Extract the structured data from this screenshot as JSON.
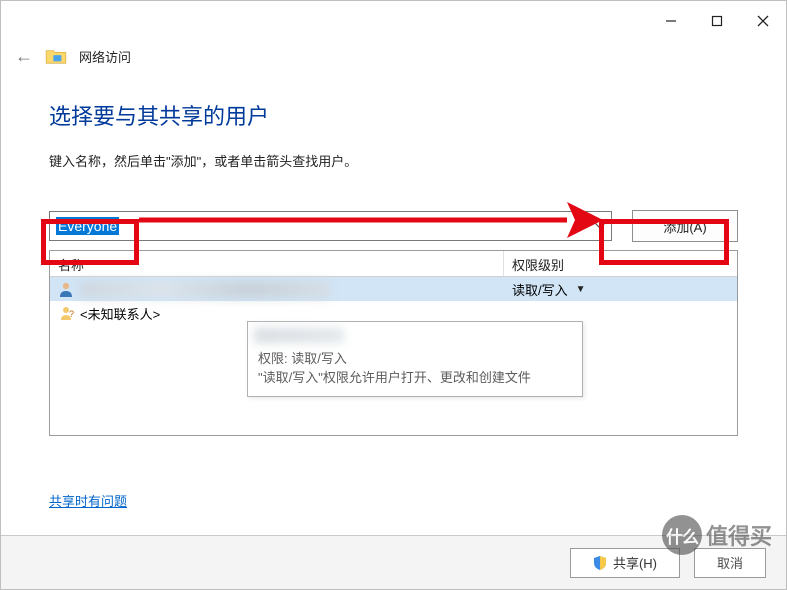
{
  "header": {
    "title": "网络访问"
  },
  "main": {
    "heading": "选择要与其共享的用户",
    "instruction": "键入名称，然后单击\"添加\"，或者单击箭头查找用户。"
  },
  "input": {
    "value": "Everyone"
  },
  "buttons": {
    "add": "添加(A)",
    "share": "共享(H)",
    "cancel": "取消"
  },
  "table": {
    "header_name": "名称",
    "header_perm": "权限级别",
    "rows": [
      {
        "name_redacted": true,
        "perm": "读取/写入",
        "selected": true,
        "icon": "user"
      },
      {
        "name": "<未知联系人>",
        "perm": "",
        "selected": false,
        "icon": "contact"
      }
    ]
  },
  "tooltip": {
    "line1_prefix": "权限: ",
    "line1_value": "读取/写入",
    "line2": "\"读取/写入\"权限允许用户打开、更改和创建文件"
  },
  "link": {
    "help": "共享时有问题"
  },
  "watermark": {
    "brand_prefix": "什么",
    "brand_suffix": "值得买"
  }
}
